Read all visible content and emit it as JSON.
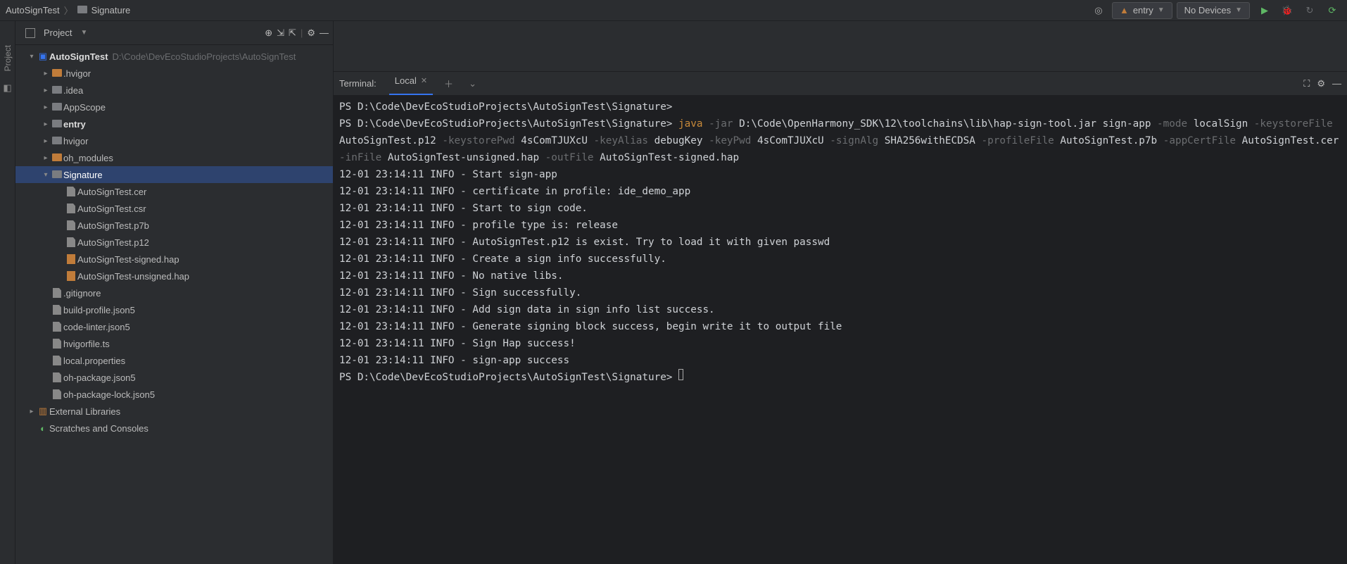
{
  "breadcrumb": {
    "root": "AutoSignTest",
    "current": "Signature"
  },
  "topbar": {
    "module": "entry",
    "device": "No Devices"
  },
  "sidebar": {
    "header": "Project",
    "root": {
      "name": "AutoSignTest",
      "path": "D:\\Code\\DevEcoStudioProjects\\AutoSignTest"
    },
    "folders": {
      "hvigorDot": ".hvigor",
      "idea": ".idea",
      "appscope": "AppScope",
      "entry": "entry",
      "hvigor": "hvigor",
      "oh_modules": "oh_modules",
      "signature": "Signature"
    },
    "sigFiles": {
      "cer": "AutoSignTest.cer",
      "csr": "AutoSignTest.csr",
      "p7b": "AutoSignTest.p7b",
      "p12": "AutoSignTest.p12",
      "signed": "AutoSignTest-signed.hap",
      "unsigned": "AutoSignTest-unsigned.hap"
    },
    "rootFiles": {
      "gitignore": ".gitignore",
      "buildProfile": "build-profile.json5",
      "codeLinter": "code-linter.json5",
      "hvigorfile": "hvigorfile.ts",
      "localProps": "local.properties",
      "ohPackage": "oh-package.json5",
      "ohPackageLock": "oh-package-lock.json5"
    },
    "extLibs": "External Libraries",
    "scratches": "Scratches and Consoles"
  },
  "terminal": {
    "title": "Terminal:",
    "tab": "Local",
    "prompt": "PS D:\\Code\\DevEcoStudioProjects\\AutoSignTest\\Signature>",
    "cmd": "java",
    "args": {
      "jarFlag": "-jar",
      "jarPath": "D:\\Code\\OpenHarmony_SDK\\12\\toolchains\\lib\\hap-sign-tool.jar sign-app",
      "modeFlag": "-mode",
      "mode": "localSign",
      "keystoreFileFlag": "-keystoreFile",
      "keystoreFile": "AutoSignTest.p12",
      "keystorePwdFlag": "-keystorePwd",
      "keystorePwd": "4sComTJUXcU",
      "keyAliasFlag": "-keyAlias",
      "keyAlias": "debugKey",
      "keyPwdFlag": "-keyPwd",
      "keyPwd": "4sComTJUXcU",
      "signAlgFlag": "-signAlg",
      "signAlg": "SHA256withECDSA",
      "profileFileFlag": "-profileFile",
      "profileFile": "AutoSignTest.p7b",
      "appCertFileFlag": "-appCertFile",
      "appCertFile": "AutoSignTest.cer",
      "inFileFlag": "-inFile",
      "inFile": "AutoSignTest-unsigned.hap",
      "outFileFlag": "-outFile",
      "outFile": "AutoSignTest-signed.hap"
    },
    "logs": [
      "12-01 23:14:11 INFO  - Start sign-app",
      "12-01 23:14:11 INFO  - certificate in profile: ide_demo_app",
      "12-01 23:14:11 INFO  - Start to sign code.",
      "12-01 23:14:11 INFO  - profile type is: release",
      "12-01 23:14:11 INFO  - AutoSignTest.p12 is exist. Try to load it with given passwd",
      "12-01 23:14:11 INFO  - Create a sign info successfully.",
      "12-01 23:14:11 INFO  - No native libs.",
      "12-01 23:14:11 INFO  - Sign successfully.",
      "12-01 23:14:11 INFO  - Add sign data in sign info list success.",
      "12-01 23:14:11 INFO  - Generate signing block success, begin write it to output file",
      "12-01 23:14:11 INFO  - Sign Hap success!",
      "12-01 23:14:11 INFO  - sign-app success"
    ]
  },
  "gutter": {
    "project": "Project"
  }
}
